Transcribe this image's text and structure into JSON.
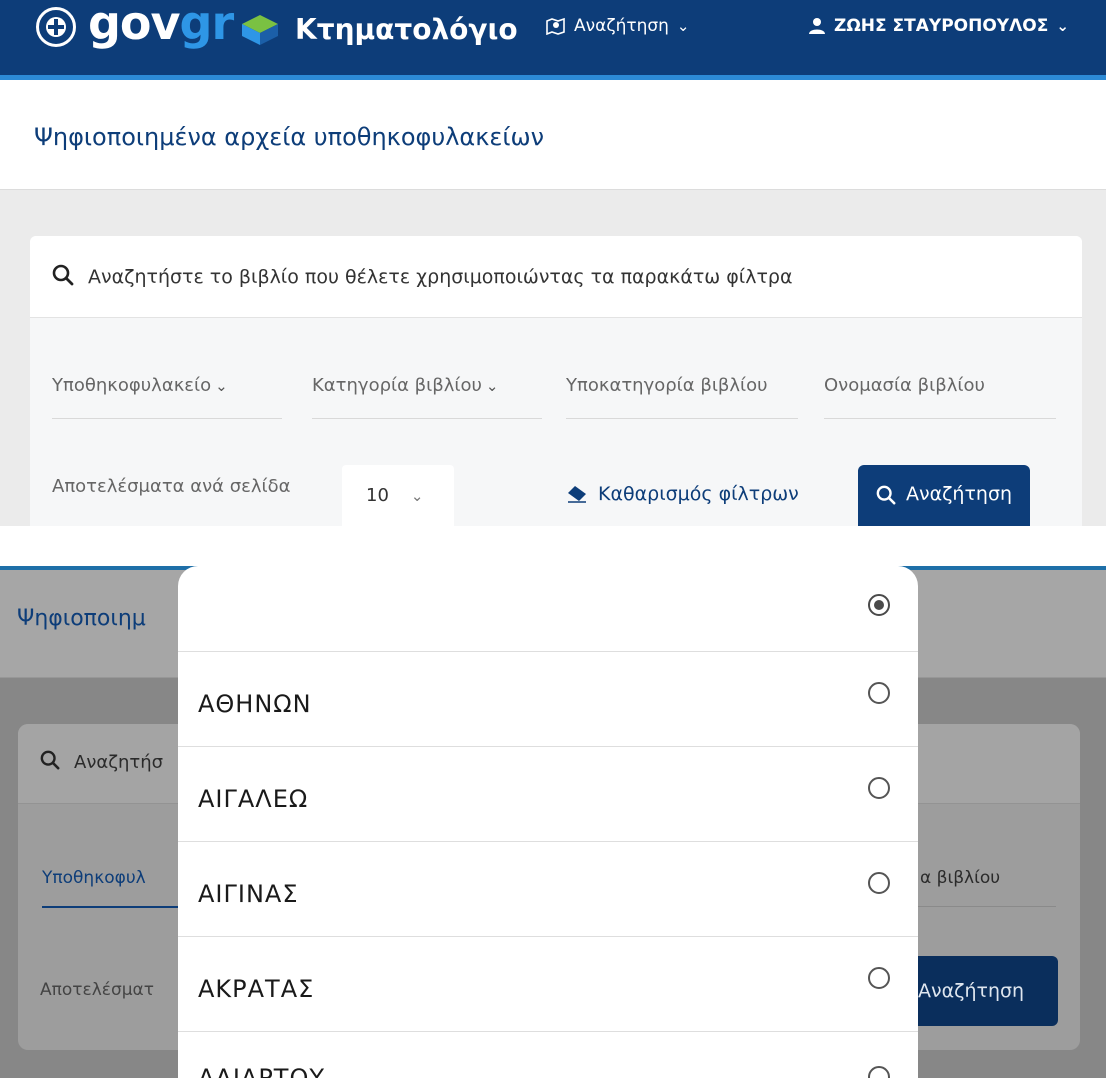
{
  "header": {
    "gov_logo_part1": "gov",
    "gov_logo_part2": "gr",
    "app_title": "Κτηματολόγιο",
    "nav_search_label": "Αναζήτηση",
    "user_name": "ΖΩΗΣ ΣΤΑΥΡΟΠΟΥΛΟΣ",
    "brand_color": "#0d3d79",
    "accent_color": "#2e96e6"
  },
  "page": {
    "title": "Ψηφιοποιημένα αρχεία υποθηκοφυλακείων"
  },
  "search_card": {
    "heading": "Αναζητήστε το βιβλίο που θέλετε χρησιμοποιώντας τα παρακάτω φίλτρα",
    "filters": [
      {
        "label": "Υποθηκοφυλακείο",
        "has_caret": true
      },
      {
        "label": "Κατηγορία βιβλίου",
        "has_caret": true
      },
      {
        "label": "Υποκατηγορία βιβλίου",
        "has_caret": true
      },
      {
        "label": "Ονομασία βιβλίου",
        "has_caret": false
      }
    ],
    "results_per_page_label": "Αποτελέσματα ανά σελίδα",
    "results_per_page_value": "10",
    "clear_filters_label": "Καθαρισμός φίλτρων",
    "search_button_label": "Αναζήτηση"
  },
  "bottom_view": {
    "title_partial": "Ψηφιοποιημ",
    "search_text_partial": "Αναζητήσ",
    "filter_label_partial": "Υποθηκοφυλ",
    "filter_right_partial": "α βιβλίου",
    "rpp_partial": "Αποτελέσματ",
    "search_button_partial": "Αναζήτηση",
    "dropdown": {
      "selected_index": 0,
      "options": [
        "",
        "ΑΘΗΝΩΝ",
        "ΑΙΓΑΛΕΩ",
        "ΑΙΓΙΝΑΣ",
        "ΑΚΡΑΤΑΣ",
        "ΑΛΙΑΡΤΟΥ"
      ]
    }
  }
}
